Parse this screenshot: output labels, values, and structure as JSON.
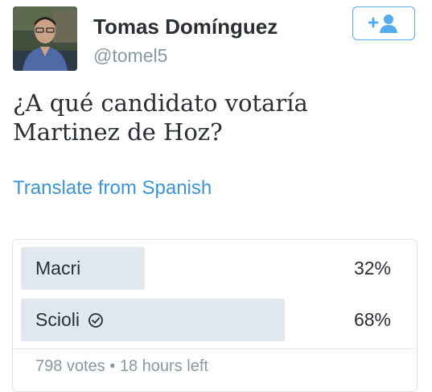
{
  "author": {
    "name": "Tomas Domínguez",
    "handle": "@tomel5",
    "avatar_icon": "profile-photo"
  },
  "follow_button": {
    "icon": "follow-user-icon",
    "color": "#55acee"
  },
  "tweet": {
    "text": "¿A qué candidato votaría Martinez de Hoz?",
    "translate_label": "Translate from Spanish"
  },
  "poll": {
    "options": [
      {
        "label": "Macri",
        "percent_text": "32%",
        "percent": 32,
        "selected": false
      },
      {
        "label": "Scioli",
        "percent_text": "68%",
        "percent": 68,
        "selected": true,
        "selected_icon": "check-circle-icon"
      }
    ],
    "votes": "798 votes",
    "separator": "•",
    "time_left": "18 hours left"
  },
  "colors": {
    "link": "#3b94d9",
    "muted": "#8899a6",
    "bar": "#e1e8ed",
    "text": "#292f33"
  }
}
